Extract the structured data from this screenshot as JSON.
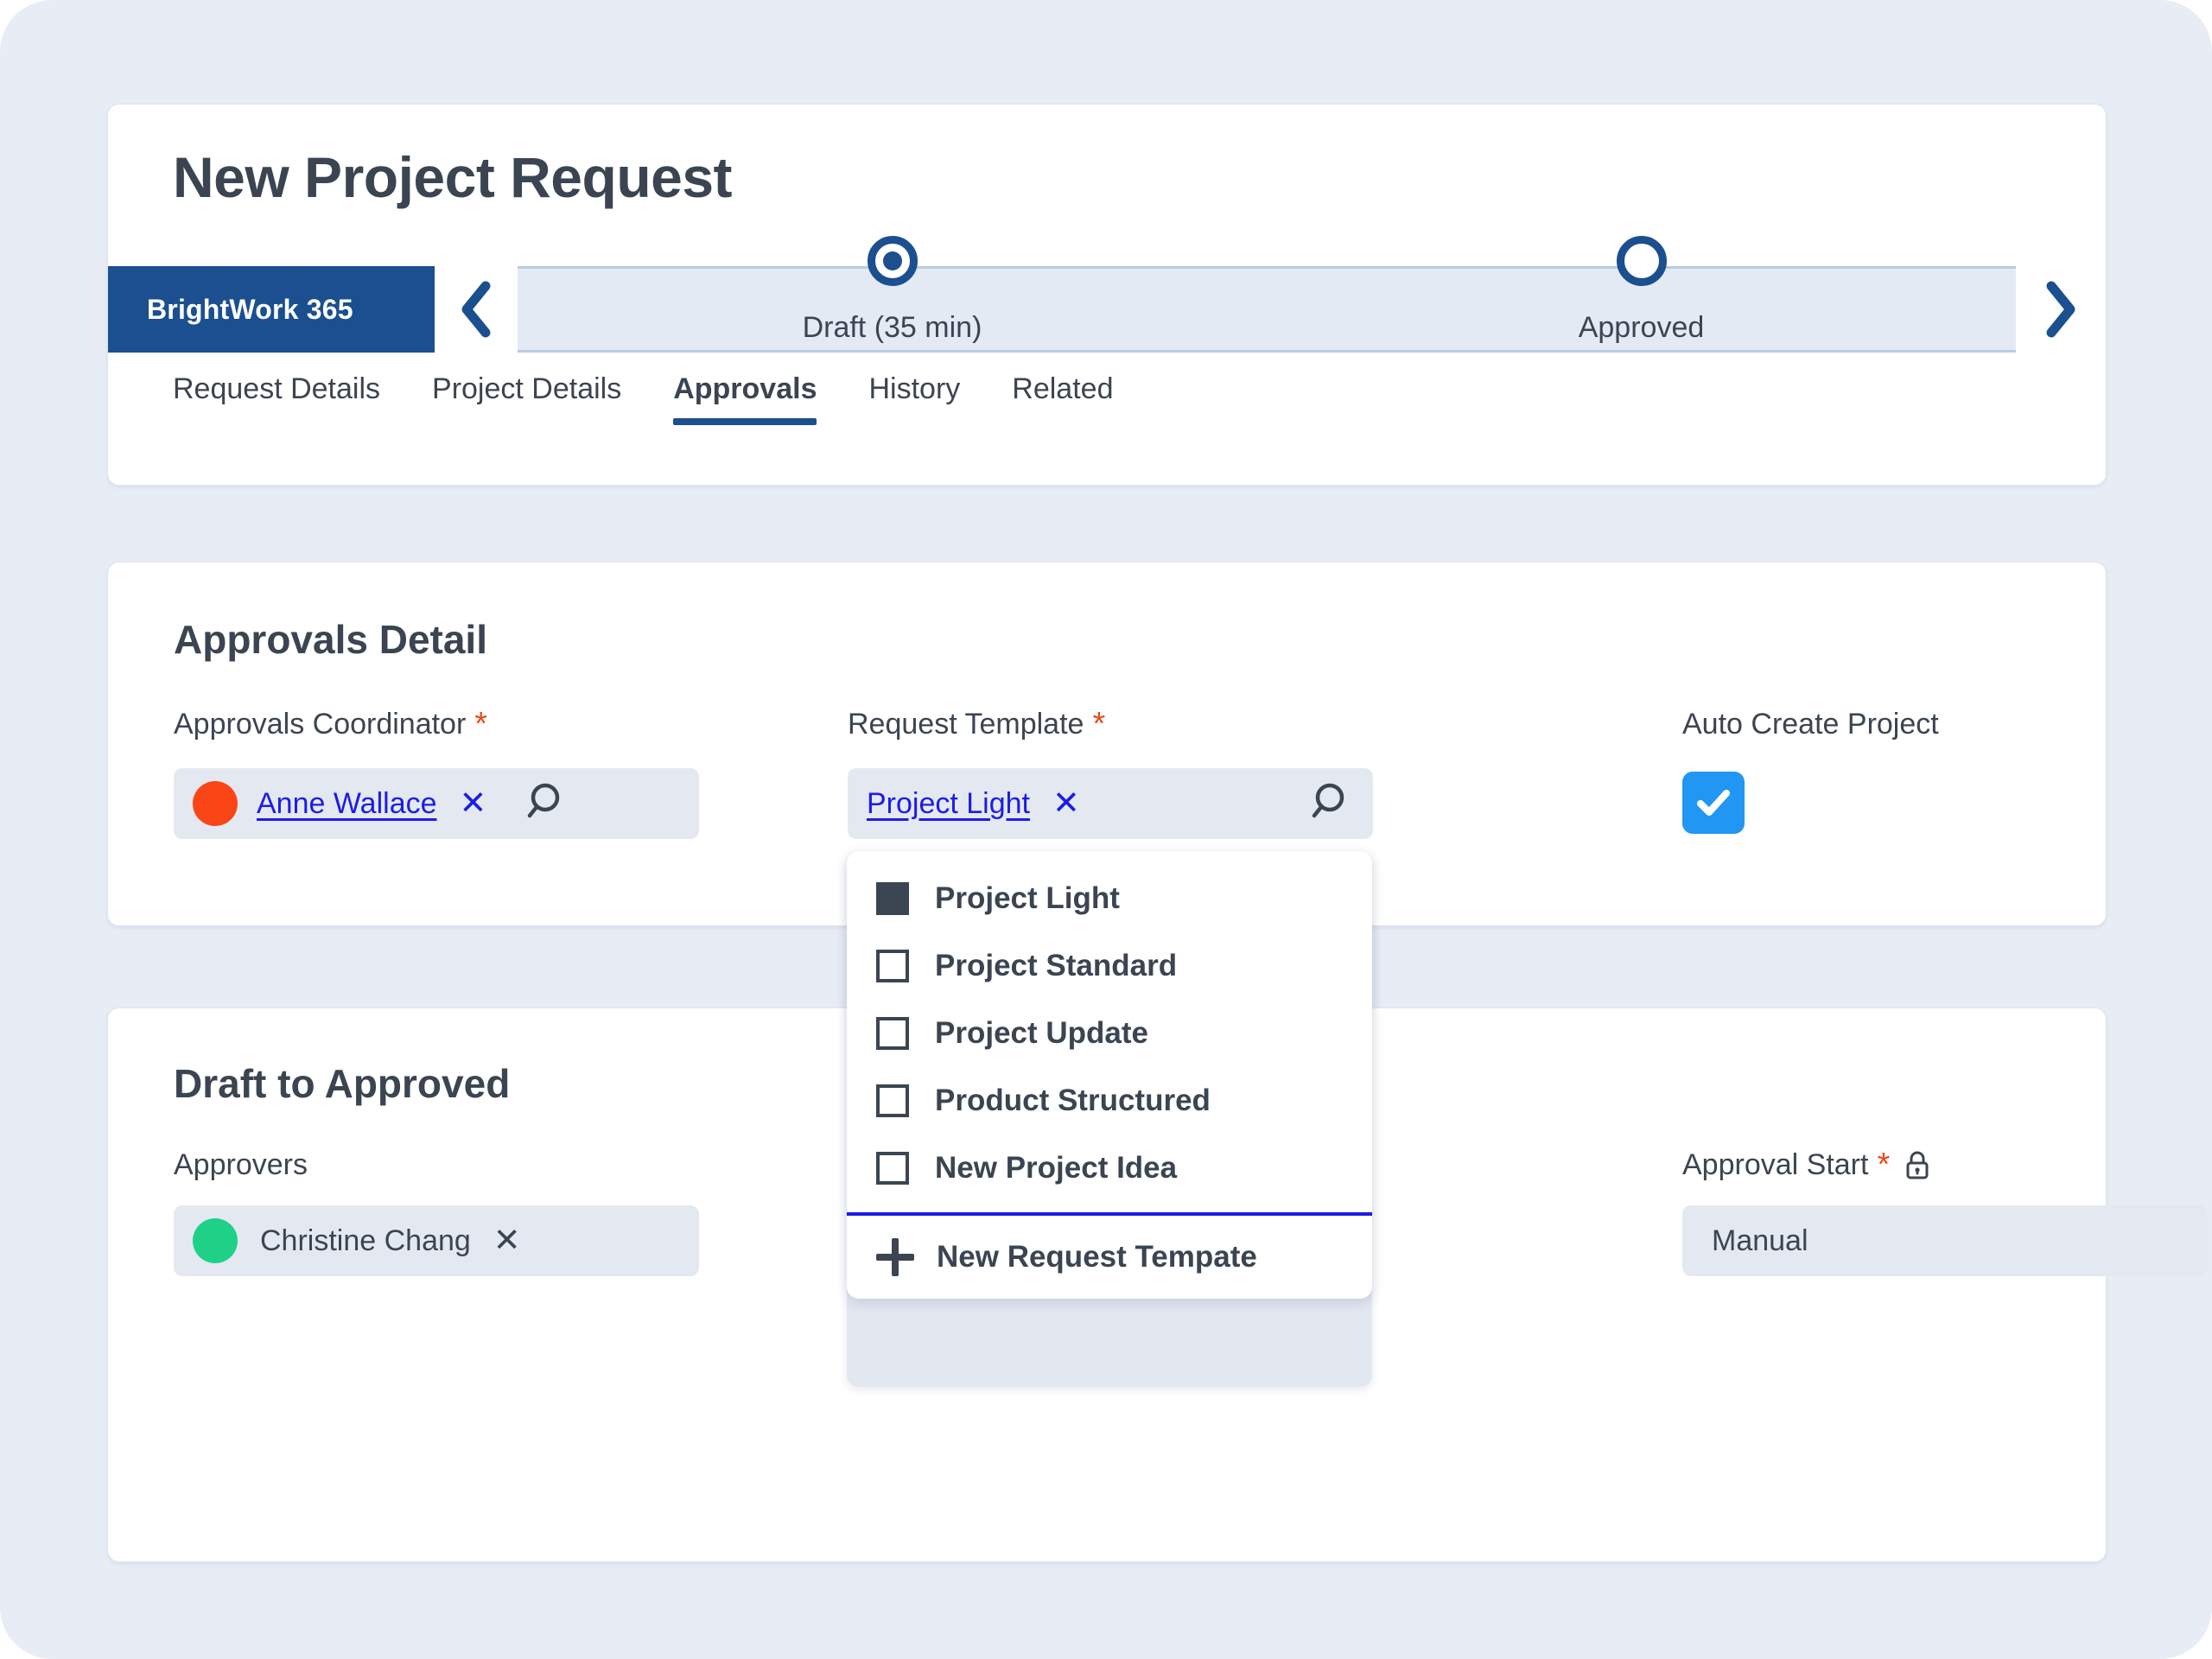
{
  "header": {
    "title": "New Project Request"
  },
  "process_flow": {
    "brand": "BrightWork 365",
    "prev_icon": "chevron-left-icon",
    "next_icon": "chevron-right-icon",
    "stages": [
      {
        "label": "Draft (35 min)",
        "state": "active"
      },
      {
        "label": "Approved",
        "state": "inactive"
      }
    ]
  },
  "tabs": [
    {
      "label": "Request Details",
      "active": false
    },
    {
      "label": "Project Details",
      "active": false
    },
    {
      "label": "Approvals",
      "active": true
    },
    {
      "label": "History",
      "active": false
    },
    {
      "label": "Related",
      "active": false
    }
  ],
  "approvals_detail": {
    "title": "Approvals Detail",
    "coordinator": {
      "label": "Approvals Coordinator",
      "required_marker": "*",
      "value": "Anne Wallace",
      "avatar_color": "#fa4616",
      "clear_label": "✕",
      "search_icon": "search-icon"
    },
    "request_template": {
      "label": "Request Template",
      "required_marker": "*",
      "value": "Project Light",
      "clear_label": "✕",
      "search_icon": "search-icon"
    },
    "auto_create_project": {
      "label": "Auto Create Project",
      "checked": true,
      "check_color": "#2196f3"
    }
  },
  "template_dropdown": {
    "options": [
      {
        "label": "Project Light",
        "selected": true
      },
      {
        "label": "Project Standard",
        "selected": false
      },
      {
        "label": "Project Update",
        "selected": false
      },
      {
        "label": "Product Structured",
        "selected": false
      },
      {
        "label": "New Project Idea",
        "selected": false
      }
    ],
    "new_item_label": "New Request Tempate",
    "new_item_icon": "plus-icon"
  },
  "draft_to_approved": {
    "title": "Draft to Approved",
    "approvers": {
      "label": "Approvers",
      "value": "Christine Chang",
      "avatar_color": "#1fd186",
      "clear_label": "✕"
    },
    "approval_start": {
      "label": "Approval Start",
      "required_marker": "*",
      "lock_icon": "lock-icon",
      "value": "Manual"
    }
  },
  "colors": {
    "page_background": "#e7ecf5",
    "brand_blue": "#1b4f8f",
    "link_blue": "#1c1ce6",
    "accent_required": "#ec4a1e",
    "text_dark": "#3b4552",
    "field_fill": "#e4e9f1"
  }
}
